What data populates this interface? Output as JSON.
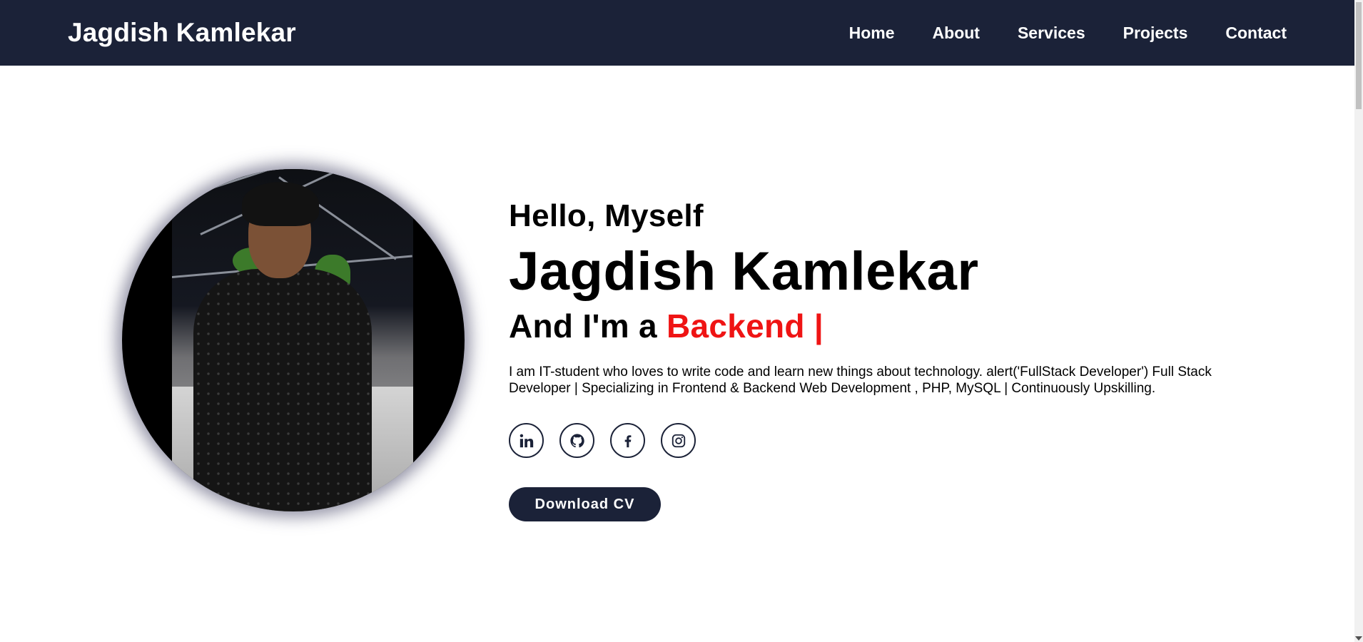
{
  "header": {
    "logo": "Jagdish Kamlekar",
    "nav": [
      {
        "label": "Home"
      },
      {
        "label": "About"
      },
      {
        "label": "Services"
      },
      {
        "label": "Projects"
      },
      {
        "label": "Contact"
      }
    ]
  },
  "hero": {
    "greeting": "Hello, Myself",
    "name": "Jagdish Kamlekar",
    "role_prefix": "And I'm a",
    "role_typed": "Backend |",
    "bio": "I am IT-student who loves to write code and learn new things about technology. alert('FullStack Developer') Full Stack Developer | Specializing in Frontend & Backend Web Development , PHP, MySQL | Continuously Upskilling.",
    "cv_button": "Download CV",
    "socials": [
      {
        "icon": "linkedin-icon"
      },
      {
        "icon": "github-icon"
      },
      {
        "icon": "facebook-icon"
      },
      {
        "icon": "instagram-icon"
      }
    ]
  },
  "colors": {
    "navbar": "#1b2238",
    "accent": "#ef1414",
    "text": "#000000",
    "background": "#ffffff"
  }
}
